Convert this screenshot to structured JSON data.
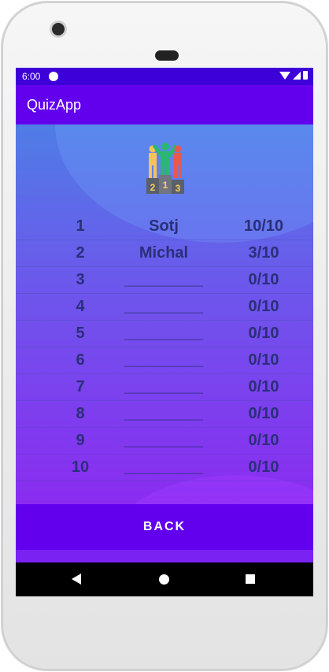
{
  "status_bar": {
    "time": "6:00"
  },
  "app_bar": {
    "title": "QuizApp"
  },
  "leaderboard": {
    "rows": [
      {
        "rank": "1",
        "name": "Sotj",
        "score": "10/10"
      },
      {
        "rank": "2",
        "name": "Michal",
        "score": "3/10"
      },
      {
        "rank": "3",
        "name": "_________",
        "score": "0/10"
      },
      {
        "rank": "4",
        "name": "_________",
        "score": "0/10"
      },
      {
        "rank": "5",
        "name": "_________",
        "score": "0/10"
      },
      {
        "rank": "6",
        "name": "_________",
        "score": "0/10"
      },
      {
        "rank": "7",
        "name": "_________",
        "score": "0/10"
      },
      {
        "rank": "8",
        "name": "_________",
        "score": "0/10"
      },
      {
        "rank": "9",
        "name": "_________",
        "score": "0/10"
      },
      {
        "rank": "10",
        "name": "_________",
        "score": "0/10"
      }
    ]
  },
  "buttons": {
    "back": "BACK"
  },
  "podium": {
    "place_labels": [
      "2",
      "1",
      "3"
    ]
  },
  "icons": {
    "status": [
      "google-icon",
      "wifi-icon",
      "signal-icon",
      "battery-icon"
    ],
    "navigation": [
      "nav-back-icon",
      "nav-home-icon",
      "nav-recents-icon"
    ],
    "trophy": "podium-icon"
  },
  "colors": {
    "status_bar": "#3d00d8",
    "app_bar": "#6200ee",
    "back_button": "#6200ee",
    "text": "#2a2f79"
  }
}
